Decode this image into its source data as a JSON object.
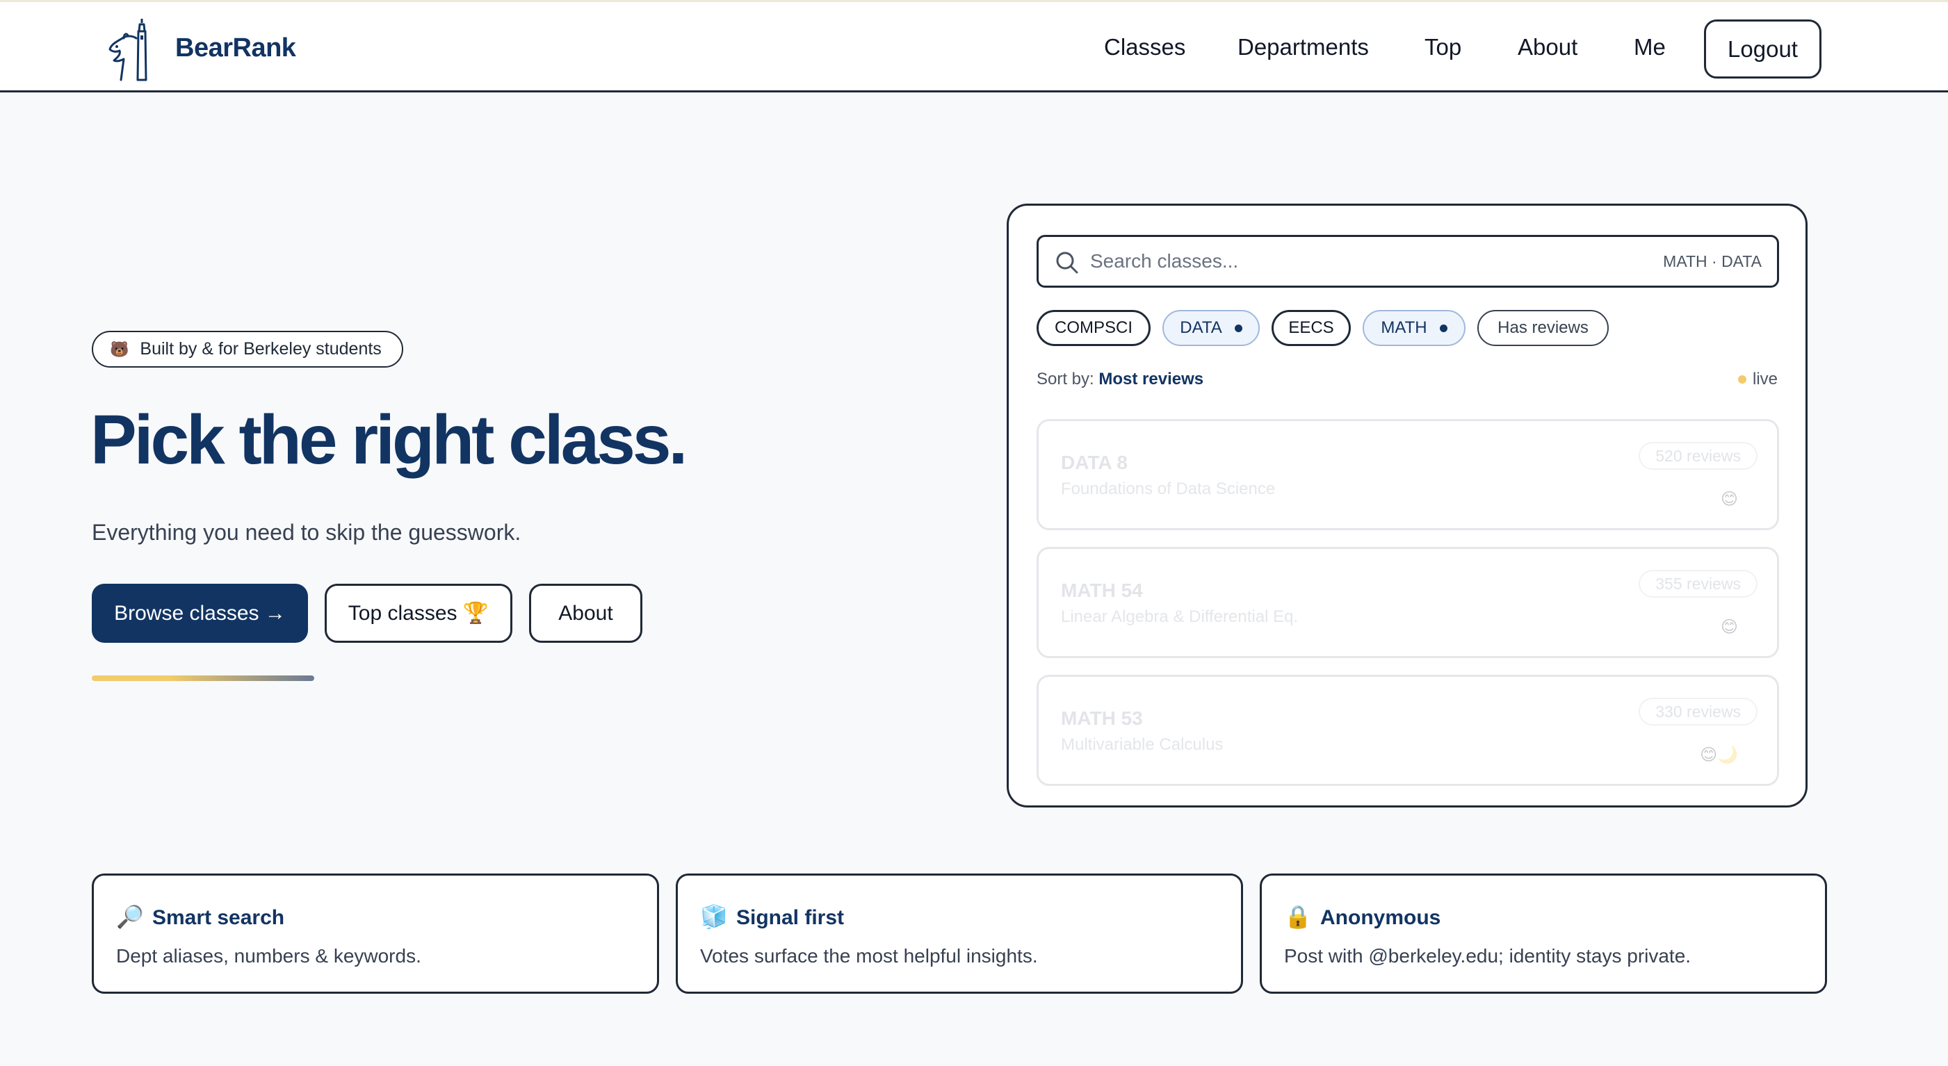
{
  "header": {
    "brand": "BearRank",
    "nav": [
      {
        "label": "Classes"
      },
      {
        "label": "Departments"
      },
      {
        "label": "Top"
      },
      {
        "label": "About"
      },
      {
        "label": "Me"
      }
    ],
    "logout_label": "Logout"
  },
  "hero": {
    "badge_icon": "🐻",
    "badge_text": "Built by & for Berkeley students",
    "title": "Pick the right class.",
    "subtitle": "Everything you need to skip the guesswork.",
    "browse_label": "Browse classes →",
    "top_label": "Top classes 🏆",
    "about_label": "About"
  },
  "panel": {
    "search_placeholder": "Search classes...",
    "search_hint": "MATH · DATA",
    "chips": [
      {
        "label": "COMPSCI",
        "active": false
      },
      {
        "label": "DATA",
        "active": true
      },
      {
        "label": "EECS",
        "active": false
      },
      {
        "label": "MATH",
        "active": true
      },
      {
        "label": "Has reviews",
        "active": false
      }
    ],
    "sort_prefix": "Sort by:",
    "sort_value": "Most reviews",
    "live_label": "live",
    "cards": [
      {
        "code": "DATA 8",
        "name": "Foundations of Data Science",
        "reviews": "520 reviews",
        "emoji": "😊"
      },
      {
        "code": "MATH 54",
        "name": "Linear Algebra & Differential Eq.",
        "reviews": "355 reviews",
        "emoji": "😊"
      },
      {
        "code": "MATH 53",
        "name": "Multivariable Calculus",
        "reviews": "330 reviews",
        "emoji": "😊🌙"
      }
    ]
  },
  "features": [
    {
      "icon": "🔎",
      "title": "Smart search",
      "desc": "Dept aliases, numbers & keywords."
    },
    {
      "icon": "🧊",
      "title": "Signal first",
      "desc": "Votes surface the most helpful insights."
    },
    {
      "icon": "🔒",
      "title": "Anonymous",
      "desc": "Post with @berkeley.edu; identity stays private."
    }
  ],
  "colors": {
    "brand_navy": "#123462",
    "accent_gold": "#f2cb6b",
    "border_dark": "#1f2937",
    "background": "#f8f9fb"
  }
}
